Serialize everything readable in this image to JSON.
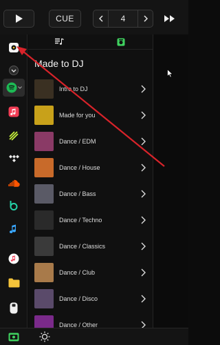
{
  "toolbar": {
    "cue_label": "CUE",
    "page_number": "4"
  },
  "section": {
    "title": "Made to DJ"
  },
  "playlists": [
    {
      "label": "Intro to DJ",
      "thumb_color": "#3a3022"
    },
    {
      "label": "Made for you",
      "thumb_color": "#c8a11a"
    },
    {
      "label": "Dance / EDM",
      "thumb_color": "#8a3a66"
    },
    {
      "label": "Dance / House",
      "thumb_color": "#c86a2a"
    },
    {
      "label": "Dance / Bass",
      "thumb_color": "#5a5a66"
    },
    {
      "label": "Dance / Techno",
      "thumb_color": "#2a2a2a"
    },
    {
      "label": "Dance / Classics",
      "thumb_color": "#3a3a3a"
    },
    {
      "label": "Dance / Club",
      "thumb_color": "#a87a4a"
    },
    {
      "label": "Dance / Disco",
      "thumb_color": "#5a4a6a"
    },
    {
      "label": "Dance / Other",
      "thumb_color": "#7a2a8a"
    }
  ],
  "sidebar": {
    "sources": [
      "local-music-icon",
      "collapse-icon",
      "spotify-icon",
      "apple-music-icon",
      "beatport-icon",
      "tidal-icon",
      "soundcloud-icon",
      "beatsource-icon",
      "itunes-icon",
      "music-app-icon",
      "folder-icon",
      "usb-icon"
    ]
  },
  "colors": {
    "accent": "#3fd25f",
    "spotify": "#1db954",
    "arrow": "#d8232a"
  }
}
